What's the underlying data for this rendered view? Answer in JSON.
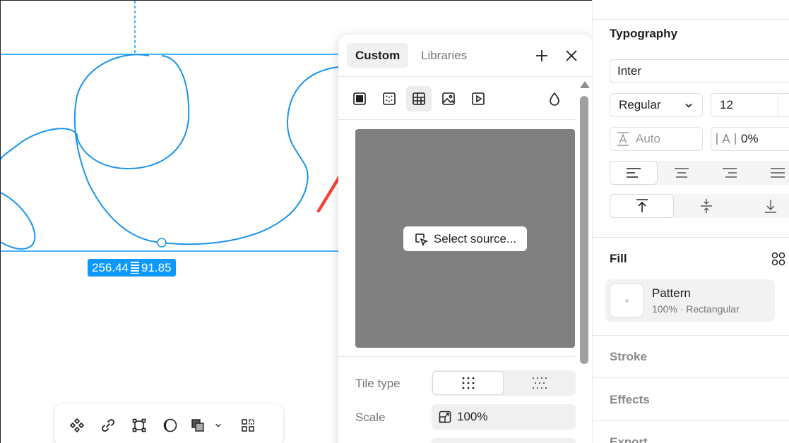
{
  "canvas": {
    "selection_color": "#0d99ff",
    "dimension_badge": {
      "width": "256.44",
      "height": "91.85"
    }
  },
  "toolbar": {
    "items": [
      "component-icon",
      "link-icon",
      "frame-icon",
      "mask-icon",
      "boolean-icon",
      "chevron-down-icon",
      "more-icon"
    ]
  },
  "picker": {
    "tabs": {
      "custom": "Custom",
      "libraries": "Libraries"
    },
    "fill_types": [
      "solid-fill-icon",
      "pattern-fill-icon",
      "grid-fill-icon",
      "image-fill-icon",
      "video-fill-icon",
      "blend-drop-icon"
    ],
    "select_source_label": "Select source...",
    "tile_type_label": "Tile type",
    "scale_label": "Scale",
    "scale_value": "100%"
  },
  "panel": {
    "typography": {
      "title": "Typography",
      "font_family": "Inter",
      "font_style": "Regular",
      "font_size": "12",
      "line_height_placeholder": "Auto",
      "letter_spacing": "0%"
    },
    "fill": {
      "title": "Fill",
      "name": "Pattern",
      "details": "100% · Rectangular"
    },
    "stroke_title": "Stroke",
    "effects_title": "Effects",
    "export_title": "Export"
  },
  "annotation": {
    "arrow_color": "#f2433b"
  }
}
